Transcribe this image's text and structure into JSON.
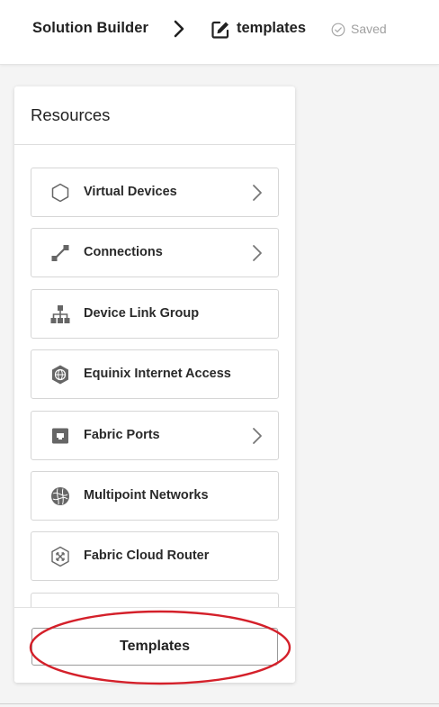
{
  "header": {
    "breadcrumb_root": "Solution Builder",
    "breadcrumb_current": "templates",
    "status": "Saved"
  },
  "panel": {
    "title": "Resources",
    "items": [
      {
        "label": "Virtual Devices",
        "icon": "hexagon-icon",
        "has_submenu": true
      },
      {
        "label": "Connections",
        "icon": "connection-icon",
        "has_submenu": true
      },
      {
        "label": "Device Link Group",
        "icon": "hierarchy-icon",
        "has_submenu": false
      },
      {
        "label": "Equinix Internet Access",
        "icon": "globe-icon",
        "has_submenu": false
      },
      {
        "label": "Fabric Ports",
        "icon": "port-icon",
        "has_submenu": true
      },
      {
        "label": "Multipoint Networks",
        "icon": "network-globe-icon",
        "has_submenu": false
      },
      {
        "label": "Fabric Cloud Router",
        "icon": "cloud-router-icon",
        "has_submenu": false
      },
      {
        "label": "",
        "icon": "partially-hidden-icon",
        "has_submenu": false
      }
    ],
    "templates_button": "Templates"
  },
  "colors": {
    "annotation": "#d4202a",
    "icon": "#666666",
    "saved": "#a0a0a0"
  }
}
